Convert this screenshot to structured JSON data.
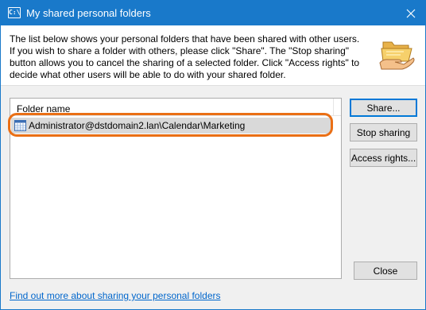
{
  "window": {
    "title": "My shared personal folders",
    "app_icon_text": "C:\\",
    "close_glyph": "✕",
    "accent_color": "#1979ca"
  },
  "description": "The list below shows your personal folders that have been shared with other users. If you wish to share a folder with others, please click \"Share\". The \"Stop sharing\" button allows you to cancel the sharing of a selected folder. Click \"Access rights\" to decide what other users will be able to do with your shared folder.",
  "list": {
    "column_header": "Folder name",
    "rows": [
      {
        "label": "Administrator@dstdomain2.lan\\Calendar\\Marketing",
        "icon": "calendar-icon",
        "selected": true
      }
    ]
  },
  "buttons": {
    "share": "Share...",
    "stop_sharing": "Stop sharing",
    "access_rights": "Access rights...",
    "close": "Close"
  },
  "help_link": "Find out more about sharing your personal folders",
  "highlight_color": "#ea6f15"
}
